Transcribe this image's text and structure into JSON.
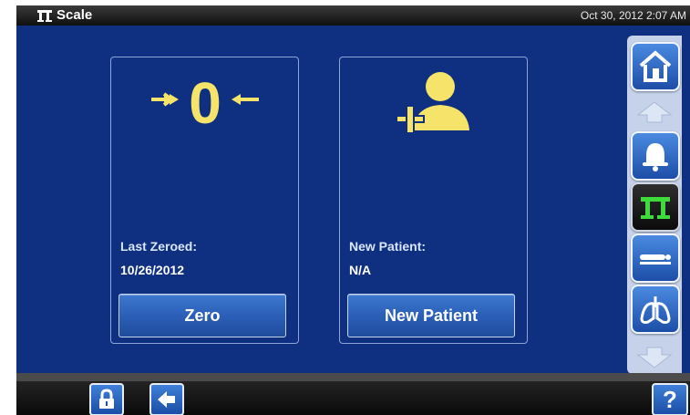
{
  "titlebar": {
    "app_title": "Scale",
    "datetime": "Oct 30, 2012 2:07 AM",
    "app_icon": "scale-icon"
  },
  "cards": [
    {
      "icon": "zero-arrows-icon",
      "label": "Last Zeroed:",
      "value": "10/26/2012",
      "button": "Zero"
    },
    {
      "icon": "add-patient-icon",
      "label": "New Patient:",
      "value": "N/A",
      "button": "New Patient"
    }
  ],
  "sidebar": {
    "items": [
      "home-icon",
      "scroll-up-icon",
      "alarm-bell-icon",
      "scale-icon",
      "bed-icon",
      "lungs-icon",
      "scroll-down-icon"
    ],
    "active": "scale-icon"
  },
  "bottombar": {
    "buttons": [
      "lock-icon",
      "back-arrow-icon"
    ],
    "help_label": "?"
  },
  "colors": {
    "accent_yellow": "#f5e36a",
    "background": "#0f2f80",
    "active_scale_green": "#3ddc3a"
  }
}
